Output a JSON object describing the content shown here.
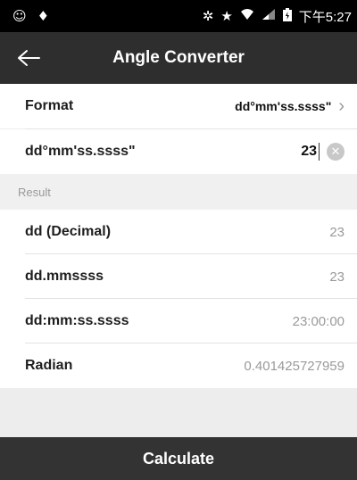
{
  "status_bar": {
    "left_icons": [
      "cat-face-icon",
      "android-bug-icon"
    ],
    "right_icons": [
      "bluetooth-icon",
      "star-icon",
      "wifi-icon",
      "signal-icon",
      "battery-icon"
    ],
    "time": "下午5:27"
  },
  "app_bar": {
    "title": "Angle Converter",
    "back_icon": "arrow-left-icon"
  },
  "format_row": {
    "label": "Format",
    "value": "dd°mm'ss.ssss\""
  },
  "input_row": {
    "label": "dd°mm'ss.ssss\"",
    "value": "23"
  },
  "result_section": {
    "header": "Result",
    "rows": [
      {
        "label": "dd (Decimal)",
        "value": "23"
      },
      {
        "label": "dd.mmssss",
        "value": "23"
      },
      {
        "label": "dd:mm:ss.ssss",
        "value": "23:00:00"
      },
      {
        "label": "Radian",
        "value": "0.401425727959"
      }
    ]
  },
  "calculate_button": {
    "label": "Calculate"
  },
  "colors": {
    "app_bar": "#2e2e2e",
    "status_bar": "#000000",
    "button": "#333333",
    "result_value": "#9a9a9a"
  }
}
